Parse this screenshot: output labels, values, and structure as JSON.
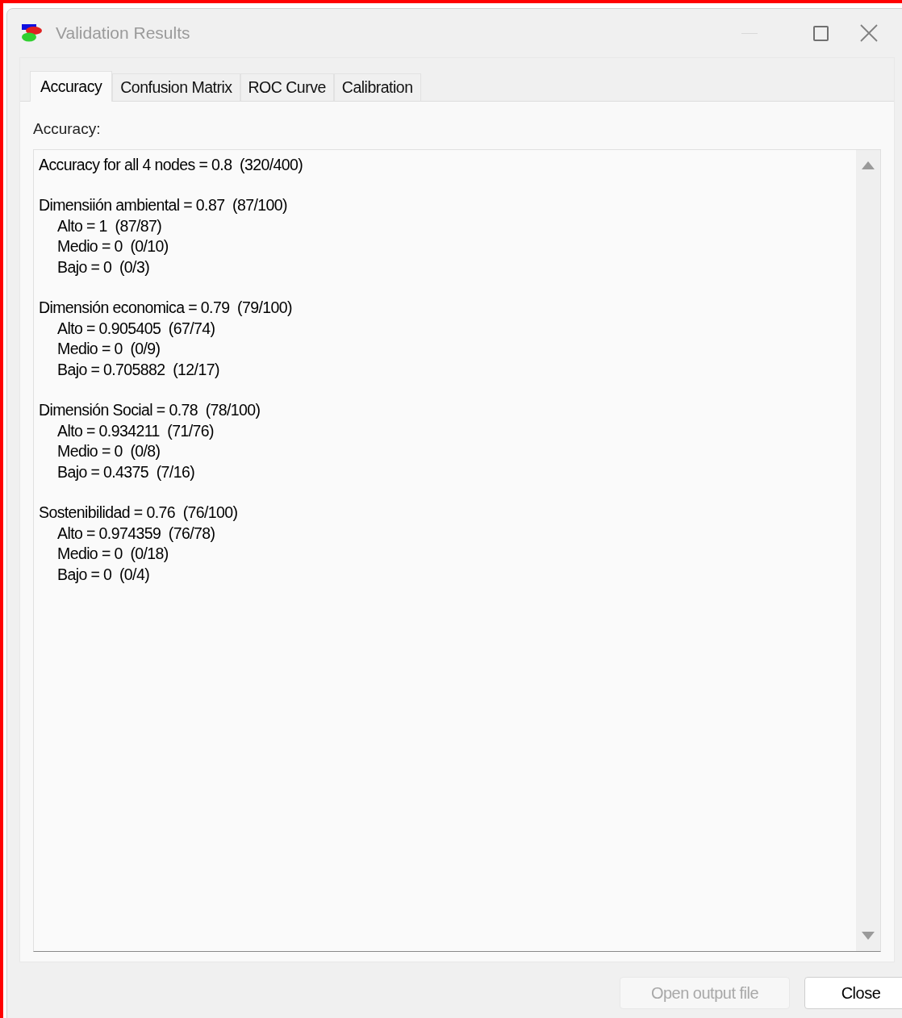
{
  "window": {
    "title": "Validation Results",
    "disabled_controls": {
      "minimize": true
    }
  },
  "tabs": [
    {
      "label": "Accuracy",
      "selected": true
    },
    {
      "label": "Confusion Matrix",
      "selected": false
    },
    {
      "label": "ROC Curve",
      "selected": false
    },
    {
      "label": "Calibration",
      "selected": false
    }
  ],
  "section_label": "Accuracy:",
  "results": {
    "summary": "Accuracy for all 4 nodes = 0.8  (320/400)",
    "nodes": [
      {
        "line": "Dimensiión ambiental = 0.87  (87/100)",
        "states": [
          "Alto = 1  (87/87)",
          "Medio = 0  (0/10)",
          "Bajo = 0  (0/3)"
        ]
      },
      {
        "line": "Dimensión economica = 0.79  (79/100)",
        "states": [
          "Alto = 0.905405  (67/74)",
          "Medio = 0  (0/9)",
          "Bajo = 0.705882  (12/17)"
        ]
      },
      {
        "line": "Dimensión Social = 0.78  (78/100)",
        "states": [
          "Alto = 0.934211  (71/76)",
          "Medio = 0  (0/8)",
          "Bajo = 0.4375  (7/16)"
        ]
      },
      {
        "line": "Sostenibilidad = 0.76  (76/100)",
        "states": [
          "Alto = 0.974359  (76/78)",
          "Medio = 0  (0/18)",
          "Bajo = 0  (0/4)"
        ]
      }
    ]
  },
  "buttons": [
    {
      "label": "Open output file",
      "disabled": true
    },
    {
      "label": "Close",
      "disabled": false
    }
  ]
}
